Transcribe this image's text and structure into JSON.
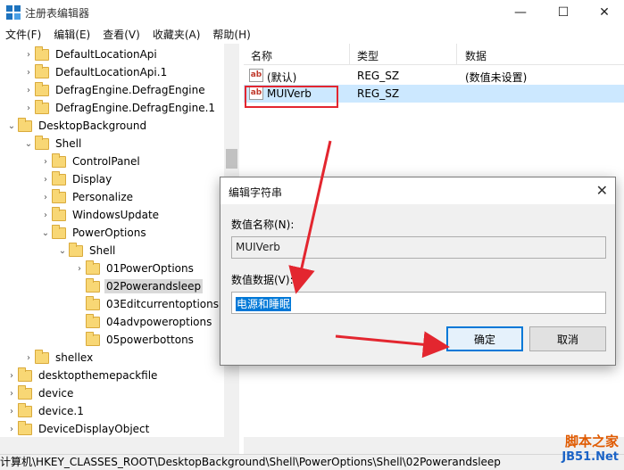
{
  "window": {
    "title": "注册表编辑器",
    "minimize": "—",
    "maximize": "☐",
    "close": "✕"
  },
  "menu": [
    "文件(F)",
    "编辑(E)",
    "查看(V)",
    "收藏夹(A)",
    "帮助(H)"
  ],
  "tree": [
    {
      "label": "DefaultLocationApi",
      "expander": ">"
    },
    {
      "label": "DefaultLocationApi.1",
      "expander": ">"
    },
    {
      "label": "DefragEngine.DefragEngine",
      "expander": ">"
    },
    {
      "label": "DefragEngine.DefragEngine.1",
      "expander": ">"
    },
    {
      "label": "DesktopBackground",
      "expander": "v"
    },
    {
      "label": "Shell",
      "expander": "v"
    },
    {
      "label": "ControlPanel",
      "expander": ">"
    },
    {
      "label": "Display",
      "expander": ">"
    },
    {
      "label": "Personalize",
      "expander": ">"
    },
    {
      "label": "WindowsUpdate",
      "expander": ">"
    },
    {
      "label": "PowerOptions",
      "expander": "v"
    },
    {
      "label": "Shell",
      "expander": "v"
    },
    {
      "label": "01PowerOptions",
      "expander": ">"
    },
    {
      "label": "02Powerandsleep",
      "expander": ""
    },
    {
      "label": "03Editcurrentoptions",
      "expander": ""
    },
    {
      "label": "04advpoweroptions",
      "expander": ""
    },
    {
      "label": "05powerbottons",
      "expander": ""
    },
    {
      "label": "shellex",
      "expander": ">"
    },
    {
      "label": "desktopthemepackfile",
      "expander": ">"
    },
    {
      "label": "device",
      "expander": ">"
    },
    {
      "label": "device.1",
      "expander": ">"
    },
    {
      "label": "DeviceDisplayObject",
      "expander": ">"
    }
  ],
  "list": {
    "headers": {
      "name": "名称",
      "type": "类型",
      "data": "数据"
    },
    "rows": [
      {
        "icon": "ab",
        "name": "(默认)",
        "type": "REG_SZ",
        "data": "(数值未设置)"
      },
      {
        "icon": "ab",
        "name": "MUIVerb",
        "type": "REG_SZ",
        "data": ""
      }
    ]
  },
  "dialog": {
    "title": "编辑字符串",
    "close": "✕",
    "name_label": "数值名称(N):",
    "name_value": "MUIVerb",
    "data_label": "数值数据(V):",
    "data_value": "电源和睡眠",
    "ok": "确定",
    "cancel": "取消"
  },
  "statusbar": "计算机\\HKEY_CLASSES_ROOT\\DesktopBackground\\Shell\\PowerOptions\\Shell\\02Powerandsleep",
  "watermark": {
    "line1": "脚本之家",
    "line2": "JB51.Net"
  },
  "colors": {
    "accent": "#0078d7",
    "highlight_box": "#e3262f",
    "selection": "#cce8ff"
  }
}
